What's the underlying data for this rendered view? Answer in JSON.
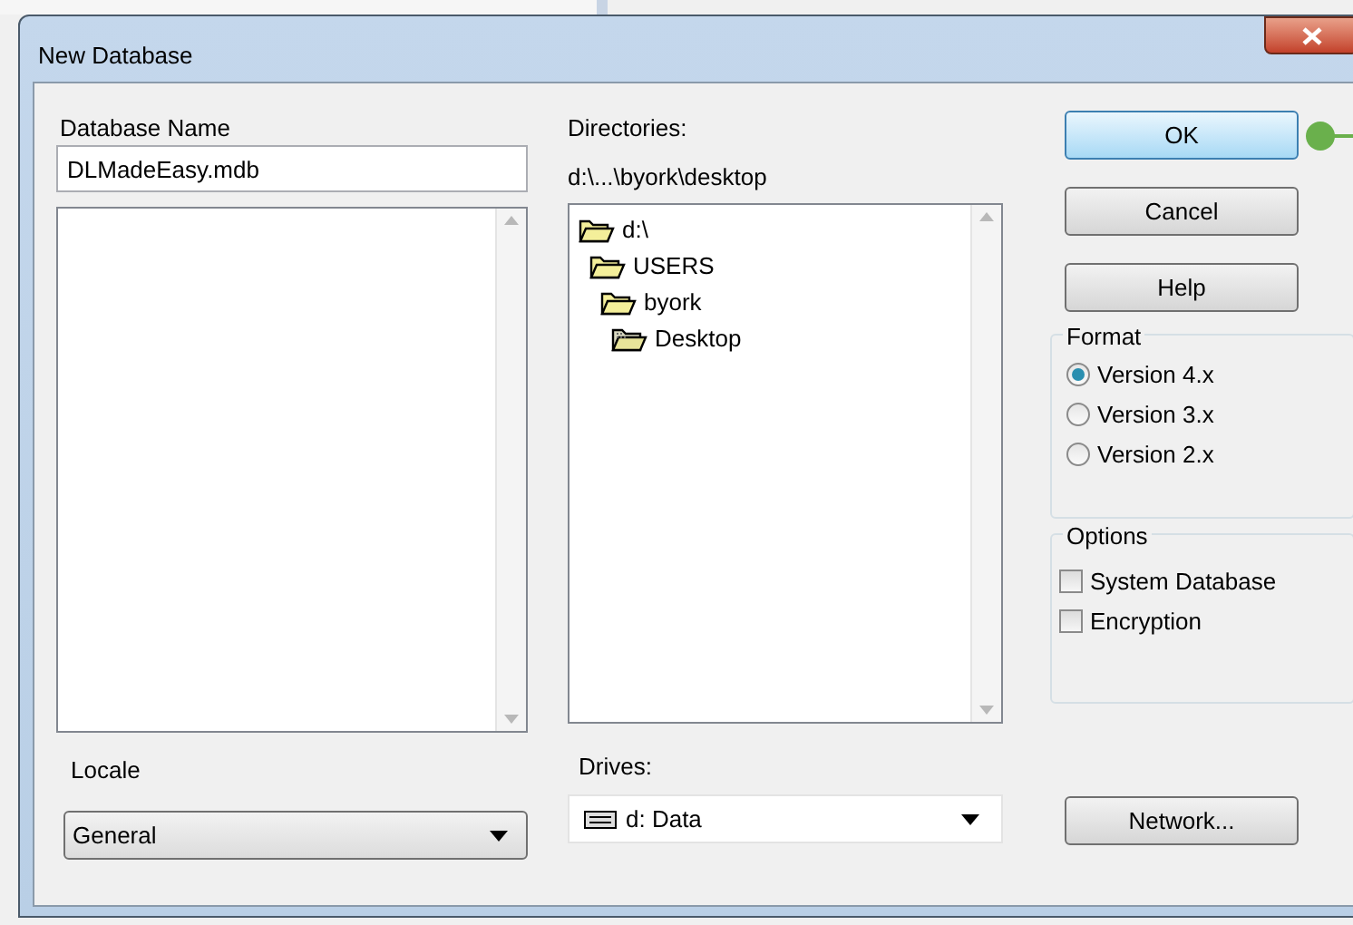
{
  "window": {
    "title": "New Database"
  },
  "database_name": {
    "label": "Database Name",
    "value": "DLMadeEasy.mdb"
  },
  "directories": {
    "label": "Directories:",
    "path": "d:\\...\\byork\\desktop",
    "tree": [
      {
        "label": "d:\\",
        "selected": false,
        "children": [
          {
            "label": "USERS",
            "selected": false,
            "children": [
              {
                "label": "byork",
                "selected": false,
                "children": [
                  {
                    "label": "Desktop",
                    "selected": true
                  }
                ]
              }
            ]
          }
        ]
      }
    ]
  },
  "locale": {
    "label": "Locale",
    "value": "General"
  },
  "drives": {
    "label": "Drives:",
    "value": "d: Data"
  },
  "buttons": [
    {
      "label": "OK",
      "default": true
    },
    {
      "label": "Cancel",
      "default": false
    },
    {
      "label": "Help",
      "default": false
    }
  ],
  "format": {
    "label": "Format",
    "options": [
      {
        "label": "Version 4.x",
        "selected": true
      },
      {
        "label": "Version 3.x",
        "selected": false
      },
      {
        "label": "Version 2.x",
        "selected": false
      }
    ]
  },
  "options": {
    "label": "Options",
    "items": [
      {
        "label": "System Database",
        "checked": false
      },
      {
        "label": "Encryption",
        "checked": false
      }
    ]
  },
  "network_button": {
    "label": "Network..."
  }
}
